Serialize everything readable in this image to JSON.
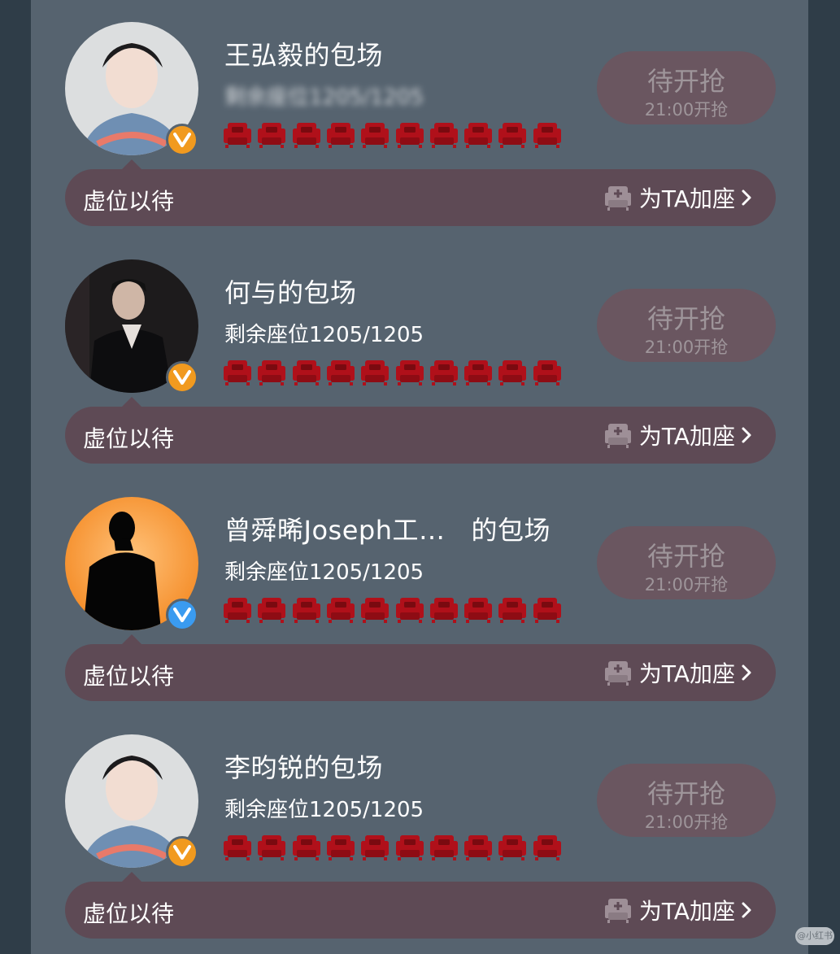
{
  "button_main_label": "待开抢",
  "button_sub_label": "21:00开抢",
  "bar_left_label": "虚位以待",
  "bar_right_label": "为TA加座",
  "colors": {
    "sofa": "#b0101a",
    "button_bg": "#6a5660",
    "bar_bg": "#5e4a55",
    "badge_orange": "#f19a1f",
    "badge_blue": "#3a9bf0"
  },
  "sofa_count": 10,
  "cards": [
    {
      "title": "王弘毅的包场",
      "seats_text": "剩余座位1205/1205",
      "seats_blurred": true,
      "badge_color": "orange",
      "avatar_style": "light-portrait"
    },
    {
      "title": "何与的包场",
      "seats_text": "剩余座位1205/1205",
      "seats_blurred": false,
      "badge_color": "orange",
      "avatar_style": "dark-suit"
    },
    {
      "title": "曾舜晞Joseph工…   的包场",
      "seats_text": "剩余座位1205/1205",
      "seats_blurred": false,
      "badge_color": "blue",
      "avatar_style": "orange-silhouette"
    },
    {
      "title": "李昀锐的包场",
      "seats_text": "剩余座位1205/1205",
      "seats_blurred": false,
      "badge_color": "orange",
      "avatar_style": "light-portrait"
    }
  ],
  "watermark": "@小红书"
}
